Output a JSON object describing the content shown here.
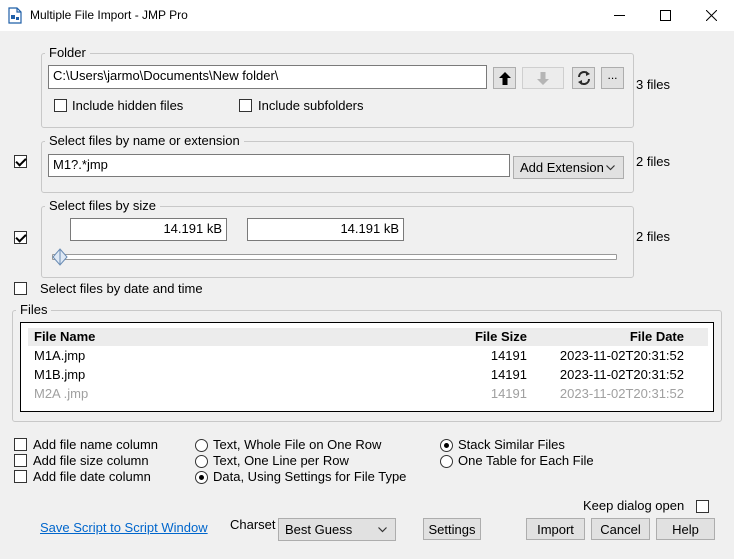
{
  "window": {
    "title": "Multiple File Import - JMP Pro"
  },
  "folder": {
    "group_label": "Folder",
    "path": "C:\\Users\\jarmo\\Documents\\New folder\\",
    "count": "3 files",
    "include_hidden_label": "Include hidden files",
    "include_hidden_checked": false,
    "include_subfolders_label": "Include subfolders",
    "include_subfolders_checked": false,
    "ellipsis_label": "..."
  },
  "by_name": {
    "enabled": true,
    "group_label": "Select files by name or extension",
    "pattern": "M1?.*jmp",
    "add_extension_label": "Add Extension",
    "count": "2 files"
  },
  "by_size": {
    "enabled": true,
    "group_label": "Select files by size",
    "min": "14.191 kB",
    "max": "14.191 kB",
    "slider_position": 0,
    "count": "2 files"
  },
  "by_date": {
    "enabled": false,
    "label": "Select files by date and time"
  },
  "files": {
    "group_label": "Files",
    "headers": {
      "name": "File Name",
      "size": "File Size",
      "date": "File Date"
    },
    "rows": [
      {
        "name": "M1A.jmp",
        "size": "14191",
        "date": "2023-11-02T20:31:52",
        "included": true
      },
      {
        "name": "M1B.jmp",
        "size": "14191",
        "date": "2023-11-02T20:31:52",
        "included": true
      },
      {
        "name": "M2A .jmp",
        "size": "14191",
        "date": "2023-11-02T20:31:52",
        "included": false
      }
    ]
  },
  "options": {
    "add_name_col": "Add file name column",
    "add_size_col": "Add file size column",
    "add_date_col": "Add file date column",
    "import_mode": [
      {
        "label": "Text, Whole File on One Row",
        "selected": false
      },
      {
        "label": "Text, One Line per Row",
        "selected": false
      },
      {
        "label": "Data, Using Settings for File Type",
        "selected": true
      }
    ],
    "stack_mode": [
      {
        "label": "Stack Similar Files",
        "selected": true
      },
      {
        "label": "One Table for Each File",
        "selected": false
      }
    ]
  },
  "footer": {
    "keep_open_label": "Keep dialog open",
    "keep_open_checked": false,
    "save_script_label": "Save Script to Script Window",
    "charset_label": "Charset",
    "charset_value": "Best Guess",
    "settings_label": "Settings",
    "import_label": "Import",
    "cancel_label": "Cancel",
    "help_label": "Help"
  }
}
